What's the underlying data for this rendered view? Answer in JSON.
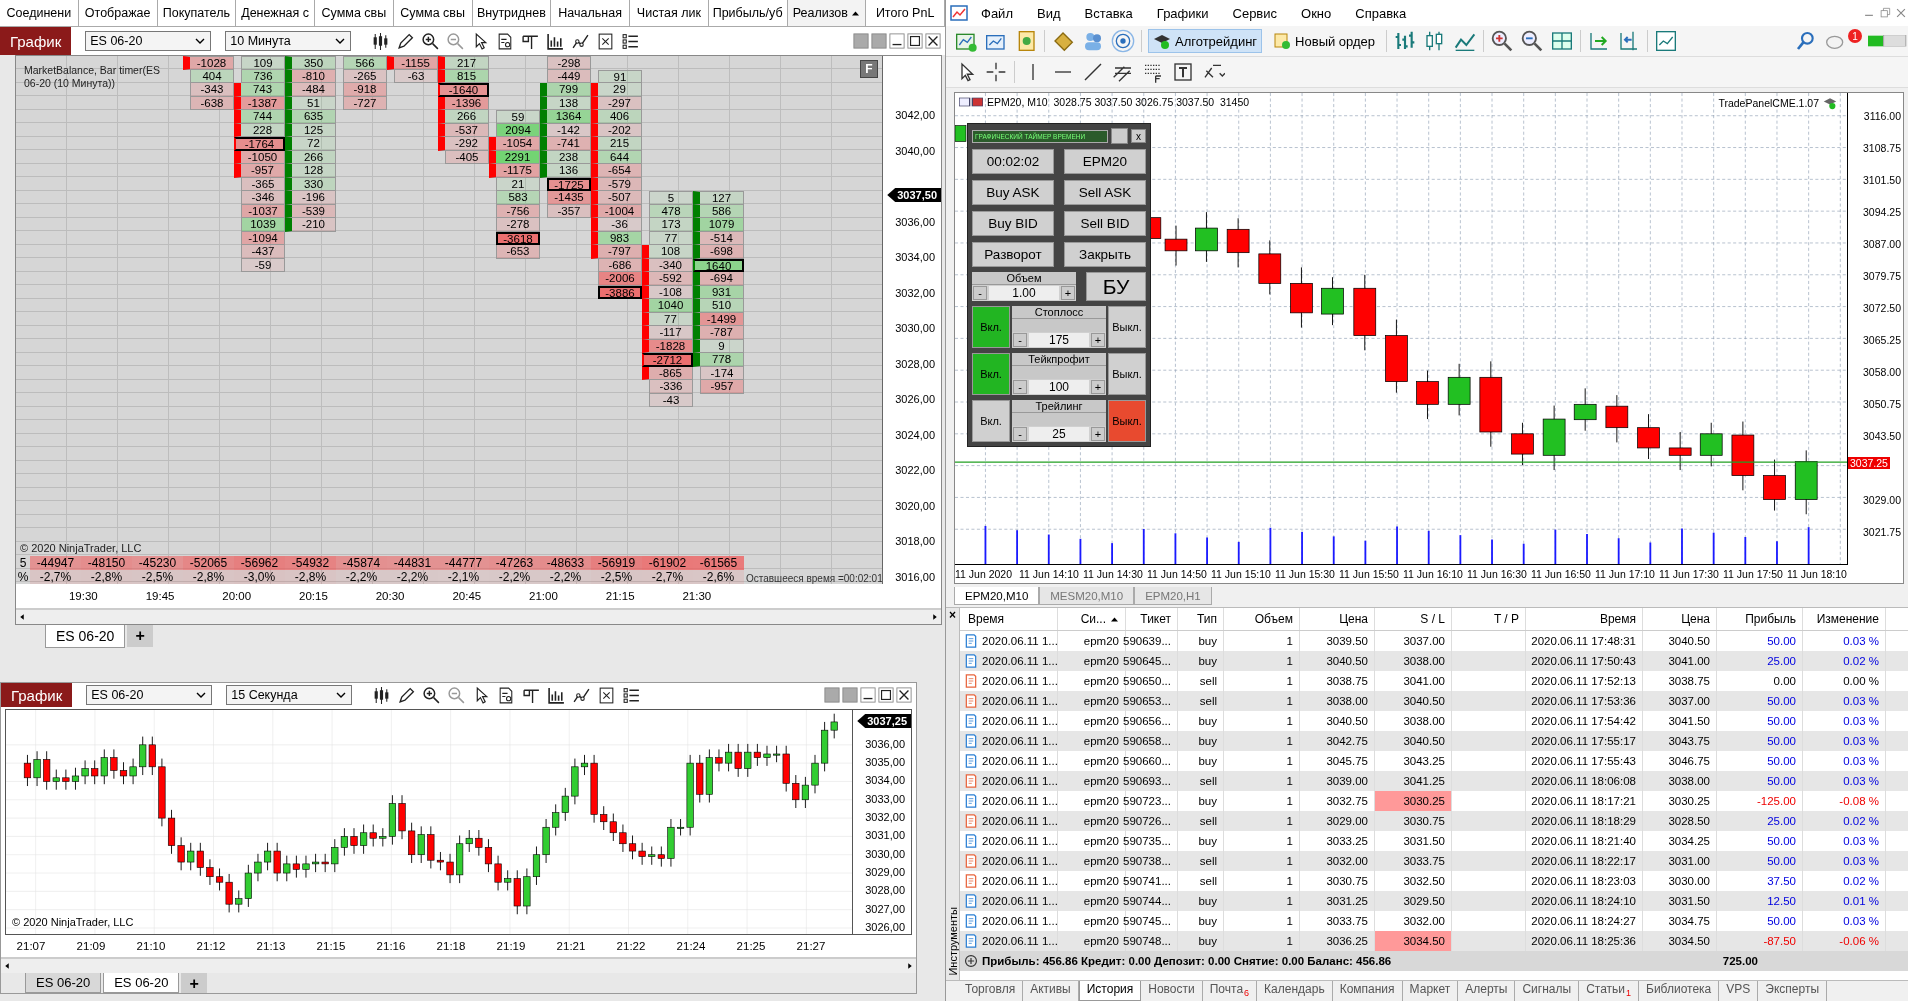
{
  "left_tabs": [
    {
      "label": "Соединени",
      "sorted": false
    },
    {
      "label": "Отображае",
      "sorted": false
    },
    {
      "label": "Покупатель",
      "sorted": false
    },
    {
      "label": "Денежная с",
      "sorted": false
    },
    {
      "label": "Сумма свы",
      "sorted": false
    },
    {
      "label": "Сумма свы",
      "sorted": false
    },
    {
      "label": "Внутриднев",
      "sorted": false
    },
    {
      "label": "Начальная",
      "sorted": false
    },
    {
      "label": "Чистая лик",
      "sorted": false
    },
    {
      "label": "Прибыль/уб",
      "sorted": false
    },
    {
      "label": "Реализов",
      "sorted": true
    },
    {
      "label": "Итого PnL",
      "sorted": false
    }
  ],
  "footprint_window": {
    "chart_button": "График",
    "instrument": "ES 06-20",
    "period": "10 Минута",
    "title": "MarketBalance, Bar timer(ES 06-20 (10 Минута))",
    "f_button": "F",
    "columns": [
      {
        "kind": "down",
        "cells": [
          {
            "v": "-1028",
            "body": true,
            "max": false
          },
          {
            "v": "404",
            "body": false,
            "max": false
          },
          {
            "v": "-343",
            "body": false,
            "max": false
          },
          {
            "v": "-638",
            "body": false,
            "max": false
          }
        ]
      },
      {
        "kind": "down",
        "cells": [
          {
            "v": "109",
            "body": false,
            "max": false
          },
          {
            "v": "736",
            "body": false,
            "max": false
          },
          {
            "v": "743",
            "body": true,
            "max": false
          },
          {
            "v": "-1387",
            "body": true,
            "max": false
          },
          {
            "v": "744",
            "body": true,
            "max": false
          },
          {
            "v": "228",
            "body": true,
            "max": false
          },
          {
            "v": "-1764",
            "body": true,
            "max": true
          },
          {
            "v": "-1050",
            "body": true,
            "max": false
          },
          {
            "v": "-957",
            "body": true,
            "max": false
          },
          {
            "v": "-365",
            "body": false,
            "max": false
          },
          {
            "v": "-346",
            "body": false,
            "max": false
          },
          {
            "v": "-1037",
            "body": false,
            "max": false
          },
          {
            "v": "1039",
            "body": false,
            "max": false
          },
          {
            "v": "-1094",
            "body": false,
            "max": false
          },
          {
            "v": "-437",
            "body": false,
            "max": false
          },
          {
            "v": "-59",
            "body": false,
            "max": false
          }
        ]
      },
      {
        "kind": "up",
        "cells": [
          {
            "v": "350",
            "body": true,
            "max": false
          },
          {
            "v": "-810",
            "body": true,
            "max": false
          },
          {
            "v": "-484",
            "body": true,
            "max": false
          },
          {
            "v": "51",
            "body": true,
            "max": false
          },
          {
            "v": "635",
            "body": true,
            "max": false
          },
          {
            "v": "125",
            "body": true,
            "max": false
          },
          {
            "v": "72",
            "body": true,
            "max": false
          },
          {
            "v": "266",
            "body": true,
            "max": false
          },
          {
            "v": "128",
            "body": true,
            "max": false
          },
          {
            "v": "330",
            "body": true,
            "max": false
          },
          {
            "v": "-196",
            "body": true,
            "max": false
          },
          {
            "v": "-539",
            "body": true,
            "max": false
          },
          {
            "v": "-210",
            "body": true,
            "max": false
          }
        ]
      },
      {
        "cells": [
          {
            "v": "566",
            "body": false,
            "max": false
          },
          {
            "v": "-265",
            "body": false,
            "max": false
          },
          {
            "v": "-918",
            "body": false,
            "max": false
          },
          {
            "v": "-727",
            "body": false,
            "max": false
          }
        ]
      },
      {
        "kind": "down",
        "cells": [
          {
            "v": "-1155",
            "body": true,
            "max": false
          },
          {
            "v": "-63",
            "body": false,
            "max": false
          }
        ]
      },
      {
        "kind": "down",
        "cells": [
          {
            "v": "217",
            "body": true,
            "max": false
          },
          {
            "v": "815",
            "body": true,
            "max": false
          },
          {
            "v": "-1640",
            "body": true,
            "max": true
          },
          {
            "v": "-1396",
            "body": true,
            "max": false
          },
          {
            "v": "266",
            "body": true,
            "max": false
          },
          {
            "v": "-537",
            "body": true,
            "max": false
          },
          {
            "v": "-292",
            "body": true,
            "max": false
          },
          {
            "v": "-405",
            "body": false,
            "max": false
          }
        ]
      },
      {
        "kind": "down",
        "cells": [
          null,
          null,
          null,
          null,
          {
            "v": "59",
            "body": false,
            "max": false
          },
          {
            "v": "2094",
            "body": false,
            "max": false
          },
          {
            "v": "-1054",
            "body": true,
            "max": false
          },
          {
            "v": "2291",
            "body": true,
            "max": false
          },
          {
            "v": "-1175",
            "body": true,
            "max": false
          },
          {
            "v": "21",
            "body": false,
            "max": false
          },
          {
            "v": "583",
            "body": false,
            "max": false
          },
          {
            "v": "-756",
            "body": false,
            "max": false
          },
          {
            "v": "-278",
            "body": false,
            "max": false
          },
          {
            "v": "-3618",
            "body": false,
            "max": true
          },
          {
            "v": "-653",
            "body": false,
            "max": false
          }
        ]
      },
      {
        "kind": "up",
        "cells": [
          {
            "v": "-298",
            "body": false,
            "max": false
          },
          {
            "v": "-449",
            "body": false,
            "max": false
          },
          {
            "v": "799",
            "body": true,
            "max": false
          },
          {
            "v": "138",
            "body": true,
            "max": false
          },
          {
            "v": "1364",
            "body": true,
            "max": false
          },
          {
            "v": "-142",
            "body": true,
            "max": false
          },
          {
            "v": "-741",
            "body": true,
            "max": false
          },
          {
            "v": "238",
            "body": true,
            "max": false
          },
          {
            "v": "136",
            "body": true,
            "max": false
          },
          {
            "v": "-1725",
            "body": false,
            "max": true
          },
          {
            "v": "-1435",
            "body": false,
            "max": false
          },
          {
            "v": "-357",
            "body": false,
            "max": false
          }
        ]
      },
      {
        "kind": "down",
        "cells": [
          null,
          {
            "v": "91",
            "body": false,
            "max": false
          },
          {
            "v": "29",
            "body": true,
            "max": false
          },
          {
            "v": "-297",
            "body": true,
            "max": false
          },
          {
            "v": "406",
            "body": true,
            "max": false
          },
          {
            "v": "-202",
            "body": true,
            "max": false
          },
          {
            "v": "215",
            "body": true,
            "max": false
          },
          {
            "v": "644",
            "body": true,
            "max": false
          },
          {
            "v": "-654",
            "body": true,
            "max": false
          },
          {
            "v": "-579",
            "body": true,
            "max": false
          },
          {
            "v": "-507",
            "body": true,
            "max": false
          },
          {
            "v": "-1004",
            "body": true,
            "max": false
          },
          {
            "v": "-36",
            "body": true,
            "max": false
          },
          {
            "v": "983",
            "body": true,
            "max": false
          },
          {
            "v": "-797",
            "body": true,
            "max": false
          },
          {
            "v": "-686",
            "body": false,
            "max": false
          },
          {
            "v": "-2006",
            "body": false,
            "max": false
          },
          {
            "v": "-3886",
            "body": false,
            "max": true
          }
        ]
      },
      {
        "kind": "down",
        "cells": [
          null,
          null,
          null,
          null,
          null,
          null,
          null,
          null,
          null,
          null,
          {
            "v": "5",
            "body": false,
            "max": false
          },
          {
            "v": "478",
            "body": false,
            "max": false
          },
          {
            "v": "173",
            "body": false,
            "max": false
          },
          {
            "v": "77",
            "body": false,
            "max": false
          },
          {
            "v": "108",
            "body": true,
            "max": false
          },
          {
            "v": "-340",
            "body": true,
            "max": false
          },
          {
            "v": "-592",
            "body": true,
            "max": false
          },
          {
            "v": "-108",
            "body": true,
            "max": false
          },
          {
            "v": "1040",
            "body": true,
            "max": false
          },
          {
            "v": "77",
            "body": true,
            "max": false
          },
          {
            "v": "-117",
            "body": true,
            "max": false
          },
          {
            "v": "-1828",
            "body": true,
            "max": false
          },
          {
            "v": "-2712",
            "body": true,
            "max": true
          },
          {
            "v": "-865",
            "body": true,
            "max": false
          },
          {
            "v": "-336",
            "body": false,
            "max": false
          },
          {
            "v": "-43",
            "body": false,
            "max": false
          }
        ]
      },
      {
        "kind": "up",
        "cells": [
          null,
          null,
          null,
          null,
          null,
          null,
          null,
          null,
          null,
          null,
          {
            "v": "127",
            "body": true,
            "max": false
          },
          {
            "v": "586",
            "body": true,
            "max": false
          },
          {
            "v": "1079",
            "body": true,
            "max": false
          },
          {
            "v": "-514",
            "body": true,
            "max": false
          },
          {
            "v": "-698",
            "body": true,
            "max": false
          },
          {
            "v": "1640",
            "body": true,
            "max": true
          },
          {
            "v": "-694",
            "body": true,
            "max": false
          },
          {
            "v": "931",
            "body": true,
            "max": false
          },
          {
            "v": "510",
            "body": true,
            "max": false
          },
          {
            "v": "-1499",
            "body": true,
            "max": false
          },
          {
            "v": "-787",
            "body": true,
            "max": false
          },
          {
            "v": "9",
            "body": true,
            "max": false
          },
          {
            "v": "778",
            "body": true,
            "max": false
          },
          {
            "v": "-174",
            "body": false,
            "max": false
          },
          {
            "v": "-957",
            "body": false,
            "max": false
          }
        ]
      }
    ],
    "delta_row": [
      "5",
      "-44947",
      "-48150",
      "-45230",
      "-52065",
      "-56962",
      "-54932",
      "-45874",
      "-44831",
      "-44777",
      "-47263",
      "-48633",
      "-56919",
      "-61902",
      "-61565"
    ],
    "percent_row": [
      "%",
      "-2,7%",
      "-2,8%",
      "-2,5%",
      "-2,8%",
      "-3,0%",
      "-2,8%",
      "-2,2%",
      "-2,2%",
      "-2,1%",
      "-2,2%",
      "-2,2%",
      "-2,5%",
      "-2,7%",
      "-2,6%"
    ],
    "copyright": "© 2020 NinjaTrader, LLC",
    "remaining": "Оставшееся время =00:02:01",
    "price_labels": [
      "3042,00",
      "3040,00",
      "3036,00",
      "3034,00",
      "3032,00",
      "3030,00",
      "3028,00",
      "3026,00",
      "3024,00",
      "3022,00",
      "3020,00",
      "3018,00",
      "3016,00"
    ],
    "price_marker": "3037,50",
    "time_labels": [
      "19:30",
      "19:45",
      "20:00",
      "20:15",
      "20:30",
      "20:45",
      "21:00",
      "21:15",
      "21:30"
    ],
    "tabs": [
      {
        "label": "ES 06-20",
        "selected": true
      }
    ],
    "add_tab": "+"
  },
  "mini_chart_window": {
    "chart_button": "График",
    "instrument": "ES 06-20",
    "period": "15 Секунда",
    "copyright": "© 2020 NinjaTrader, LLC",
    "price_labels": [
      "3036,00",
      "3035,00",
      "3034,00",
      "3033,00",
      "3032,00",
      "3031,00",
      "3030,00",
      "3029,00",
      "3028,00",
      "3027,00",
      "3026,00"
    ],
    "price_marker": "3037,25",
    "time_labels": [
      "21:07",
      "21:09",
      "21:10",
      "21:12",
      "21:13",
      "21:15",
      "21:16",
      "21:18",
      "21:19",
      "21:21",
      "21:22",
      "21:24",
      "21:25",
      "21:27"
    ],
    "tabs": [
      {
        "label": "ES 06-20",
        "selected": false
      },
      {
        "label": "ES 06-20",
        "selected": true
      }
    ],
    "add_tab": "+"
  },
  "terminal": {
    "menu": [
      "Файл",
      "Вид",
      "Вставка",
      "Графики",
      "Сервис",
      "Окно",
      "Справка"
    ],
    "algo_button": {
      "label": "Алготрейдинг",
      "on": true
    },
    "new_order": "Новый ордер",
    "notification_count": "1",
    "chart": {
      "header": "EPM20, M10  3028.75 3037.50 3026.75 3037.50  31450",
      "indicator": "TradePanelCME.1.07",
      "price_labels": [
        "3116.00",
        "3108.75",
        "3101.50",
        "3094.25",
        "3087.00",
        "3079.75",
        "3072.50",
        "3065.25",
        "3058.00",
        "3050.75",
        "3043.50",
        "3029.00",
        "3021.75"
      ],
      "price_marker": "3037.25",
      "time_labels": [
        "11 Jun 2020",
        "11 Jun 14:10",
        "11 Jun 14:30",
        "11 Jun 14:50",
        "11 Jun 15:10",
        "11 Jun 15:30",
        "11 Jun 15:50",
        "11 Jun 16:10",
        "11 Jun 16:30",
        "11 Jun 16:50",
        "11 Jun 17:10",
        "11 Jun 17:30",
        "11 Jun 17:50",
        "11 Jun 18:10"
      ]
    },
    "trade_panel": {
      "title": "ГРАФИЧЕСКИЙ ТАЙМЕР ВРЕМЕНИ",
      "close": "x",
      "timer": "00:02:02",
      "symbol": "EPM20",
      "buttons": [
        "Buy ASK",
        "Sell ASK",
        "Buy BID",
        "Sell BID",
        "Разворот",
        "Закрыть"
      ],
      "volume": {
        "label": "Объем",
        "minus": "-",
        "value": "1.00",
        "plus": "+"
      },
      "breakeven": "БУ",
      "settings": [
        {
          "label": "Стоплосс",
          "on_label": "Вкл.",
          "off_label": "Выкл.",
          "enabled": true,
          "minus": "-",
          "value": "175",
          "plus": "+"
        },
        {
          "label": "Тейкпрофит",
          "on_label": "Вкл.",
          "off_label": "Выкл.",
          "enabled": true,
          "minus": "-",
          "value": "100",
          "plus": "+"
        },
        {
          "label": "Трейлинг",
          "on_label": "Вкл.",
          "off_label": "Выкл.",
          "enabled": false,
          "minus": "-",
          "value": "25",
          "plus": "+"
        }
      ]
    },
    "chart_tabs": [
      {
        "label": "EPM20,M10",
        "selected": true
      },
      {
        "label": "MESM20,M10",
        "selected": false
      },
      {
        "label": "EPM20,H1",
        "selected": false
      }
    ],
    "side_label": "Инструменты",
    "side_close": "×",
    "history": {
      "columns": [
        {
          "label": "Время",
          "sorted": false
        },
        {
          "label": "Си...",
          "sorted": true
        },
        {
          "label": "Тикет",
          "sorted": false
        },
        {
          "label": "Тип",
          "sorted": false
        },
        {
          "label": "Объем",
          "sorted": false
        },
        {
          "label": "Цена",
          "sorted": false
        },
        {
          "label": "S / L",
          "sorted": false
        },
        {
          "label": "T / P",
          "sorted": false
        },
        {
          "label": "Время",
          "sorted": false
        },
        {
          "label": "Цена",
          "sorted": false
        },
        {
          "label": "Прибыль",
          "sorted": false
        },
        {
          "label": "Изменение",
          "sorted": false
        }
      ],
      "rows": [
        {
          "kind": "buy",
          "open_time": "2020.06.11 1...",
          "symbol": "epm20",
          "ticket": "590639...",
          "type": "buy",
          "volume": "1",
          "price": "3039.50",
          "sl": "3037.00",
          "sl_hit": false,
          "close_time": "2020.06.11 17:48:31",
          "close_price": "3040.50",
          "profit": "50.00",
          "change": "0.03 %"
        },
        {
          "kind": "buy",
          "open_time": "2020.06.11 1...",
          "symbol": "epm20",
          "ticket": "590645...",
          "type": "buy",
          "volume": "1",
          "price": "3040.50",
          "sl": "3038.00",
          "sl_hit": false,
          "close_time": "2020.06.11 17:50:43",
          "close_price": "3041.00",
          "profit": "25.00",
          "change": "0.02 %"
        },
        {
          "kind": "sell",
          "open_time": "2020.06.11 1...",
          "symbol": "epm20",
          "ticket": "590650...",
          "type": "sell",
          "volume": "1",
          "price": "3038.75",
          "sl": "3041.00",
          "sl_hit": false,
          "close_time": "2020.06.11 17:52:13",
          "close_price": "3038.75",
          "profit": "0.00",
          "change": "0.00 %"
        },
        {
          "kind": "sell",
          "open_time": "2020.06.11 1...",
          "symbol": "epm20",
          "ticket": "590653...",
          "type": "sell",
          "volume": "1",
          "price": "3038.00",
          "sl": "3040.50",
          "sl_hit": false,
          "close_time": "2020.06.11 17:53:36",
          "close_price": "3037.00",
          "profit": "50.00",
          "change": "0.03 %"
        },
        {
          "kind": "buy",
          "open_time": "2020.06.11 1...",
          "symbol": "epm20",
          "ticket": "590656...",
          "type": "buy",
          "volume": "1",
          "price": "3040.50",
          "sl": "3038.00",
          "sl_hit": false,
          "close_time": "2020.06.11 17:54:42",
          "close_price": "3041.50",
          "profit": "50.00",
          "change": "0.03 %"
        },
        {
          "kind": "buy",
          "open_time": "2020.06.11 1...",
          "symbol": "epm20",
          "ticket": "590658...",
          "type": "buy",
          "volume": "1",
          "price": "3042.75",
          "sl": "3040.50",
          "sl_hit": false,
          "close_time": "2020.06.11 17:55:17",
          "close_price": "3043.75",
          "profit": "50.00",
          "change": "0.03 %"
        },
        {
          "kind": "buy",
          "open_time": "2020.06.11 1...",
          "symbol": "epm20",
          "ticket": "590660...",
          "type": "buy",
          "volume": "1",
          "price": "3045.75",
          "sl": "3043.25",
          "sl_hit": false,
          "close_time": "2020.06.11 17:55:43",
          "close_price": "3046.75",
          "profit": "50.00",
          "change": "0.03 %"
        },
        {
          "kind": "sell",
          "open_time": "2020.06.11 1...",
          "symbol": "epm20",
          "ticket": "590693...",
          "type": "sell",
          "volume": "1",
          "price": "3039.00",
          "sl": "3041.25",
          "sl_hit": false,
          "close_time": "2020.06.11 18:06:08",
          "close_price": "3038.00",
          "profit": "50.00",
          "change": "0.03 %"
        },
        {
          "kind": "buy",
          "open_time": "2020.06.11 1...",
          "symbol": "epm20",
          "ticket": "590723...",
          "type": "buy",
          "volume": "1",
          "price": "3032.75",
          "sl": "3030.25",
          "sl_hit": true,
          "close_time": "2020.06.11 18:17:21",
          "close_price": "3030.25",
          "profit": "-125.00",
          "change": "-0.08 %"
        },
        {
          "kind": "sell",
          "open_time": "2020.06.11 1...",
          "symbol": "epm20",
          "ticket": "590726...",
          "type": "sell",
          "volume": "1",
          "price": "3029.00",
          "sl": "3030.75",
          "sl_hit": false,
          "close_time": "2020.06.11 18:18:29",
          "close_price": "3028.50",
          "profit": "25.00",
          "change": "0.02 %"
        },
        {
          "kind": "buy",
          "open_time": "2020.06.11 1...",
          "symbol": "epm20",
          "ticket": "590735...",
          "type": "buy",
          "volume": "1",
          "price": "3033.25",
          "sl": "3031.50",
          "sl_hit": false,
          "close_time": "2020.06.11 18:21:40",
          "close_price": "3034.25",
          "profit": "50.00",
          "change": "0.03 %"
        },
        {
          "kind": "sell",
          "open_time": "2020.06.11 1...",
          "symbol": "epm20",
          "ticket": "590738...",
          "type": "sell",
          "volume": "1",
          "price": "3032.00",
          "sl": "3033.75",
          "sl_hit": false,
          "close_time": "2020.06.11 18:22:17",
          "close_price": "3031.00",
          "profit": "50.00",
          "change": "0.03 %"
        },
        {
          "kind": "sell",
          "open_time": "2020.06.11 1...",
          "symbol": "epm20",
          "ticket": "590741...",
          "type": "sell",
          "volume": "1",
          "price": "3030.75",
          "sl": "3032.50",
          "sl_hit": false,
          "close_time": "2020.06.11 18:23:03",
          "close_price": "3030.00",
          "profit": "37.50",
          "change": "0.02 %"
        },
        {
          "kind": "buy",
          "open_time": "2020.06.11 1...",
          "symbol": "epm20",
          "ticket": "590744...",
          "type": "buy",
          "volume": "1",
          "price": "3031.25",
          "sl": "3029.50",
          "sl_hit": false,
          "close_time": "2020.06.11 18:24:10",
          "close_price": "3031.50",
          "profit": "12.50",
          "change": "0.01 %"
        },
        {
          "kind": "buy",
          "open_time": "2020.06.11 1...",
          "symbol": "epm20",
          "ticket": "590745...",
          "type": "buy",
          "volume": "1",
          "price": "3033.75",
          "sl": "3032.00",
          "sl_hit": false,
          "close_time": "2020.06.11 18:24:27",
          "close_price": "3034.75",
          "profit": "50.00",
          "change": "0.03 %"
        },
        {
          "kind": "buy",
          "open_time": "2020.06.11 1...",
          "symbol": "epm20",
          "ticket": "590748...",
          "type": "buy",
          "volume": "1",
          "price": "3036.25",
          "sl": "3034.50",
          "sl_hit": true,
          "close_time": "2020.06.11 18:25:36",
          "close_price": "3034.50",
          "profit": "-87.50",
          "change": "-0.06 %"
        }
      ],
      "footer": "Прибыль: 456.86  Кредит: 0.00  Депозит: 0.00  Снятие: 0.00  Баланс: 456.86",
      "footer_total": "725.00"
    },
    "bottom_tabs": [
      {
        "label": "Торговля",
        "selected": false
      },
      {
        "label": "Активы",
        "selected": false
      },
      {
        "label": "История",
        "selected": true
      },
      {
        "label": "Новости",
        "selected": false
      },
      {
        "label": "Почта",
        "selected": false,
        "badge": "6"
      },
      {
        "label": "Календарь",
        "selected": false
      },
      {
        "label": "Компания",
        "selected": false
      },
      {
        "label": "Маркет",
        "selected": false
      },
      {
        "label": "Алерты",
        "selected": false
      },
      {
        "label": "Сигналы",
        "selected": false
      },
      {
        "label": "Статьи",
        "selected": false,
        "badge": "1"
      },
      {
        "label": "Библиотека",
        "selected": false
      },
      {
        "label": "VPS",
        "selected": false
      },
      {
        "label": "Эксперты",
        "selected": false
      }
    ]
  }
}
